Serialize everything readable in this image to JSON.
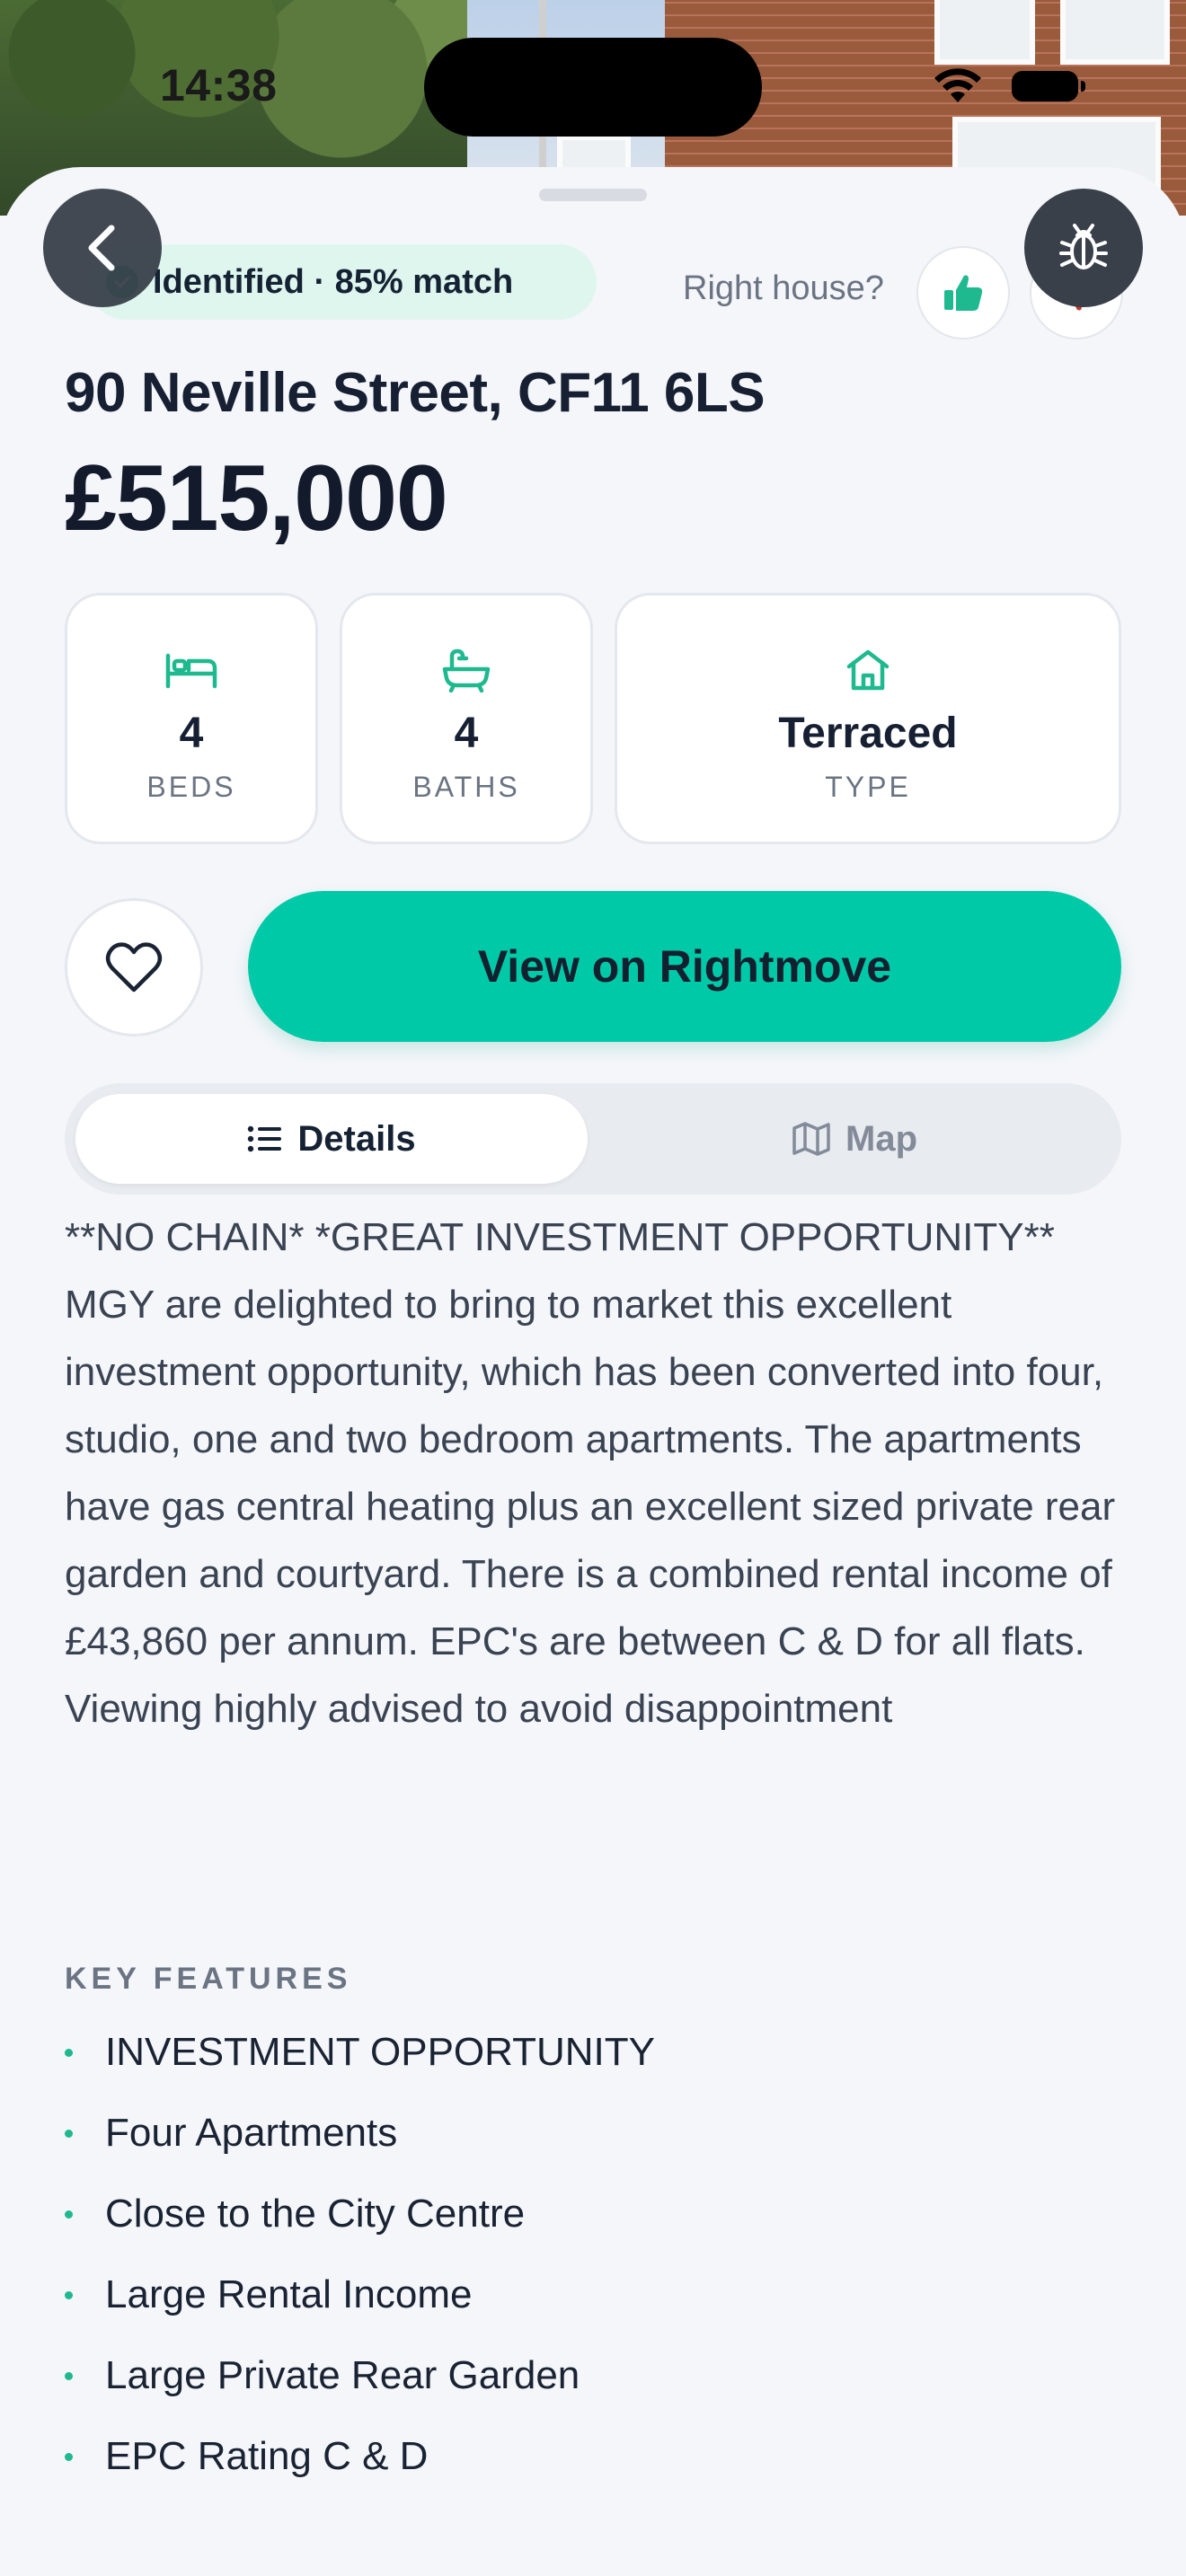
{
  "status_bar": {
    "time": "14:38"
  },
  "header": {
    "match_badge": "Identified · 85% match",
    "feedback_prompt": "Right house?"
  },
  "property": {
    "address": "90 Neville Street, CF11 6LS",
    "price": "£515,000"
  },
  "stats": [
    {
      "icon": "bed-icon",
      "value": "4",
      "label": "BEDS"
    },
    {
      "icon": "bath-icon",
      "value": "4",
      "label": "BATHS"
    },
    {
      "icon": "house-icon",
      "value": "Terraced",
      "label": "TYPE"
    }
  ],
  "actions": {
    "primary_label": "View on Rightmove"
  },
  "tabs": [
    {
      "label": "Details",
      "icon": "list-icon",
      "selected": true
    },
    {
      "label": "Map",
      "icon": "map-icon",
      "selected": false
    }
  ],
  "description": "**NO CHAIN* *GREAT INVESTMENT OPPORTUNITY** MGY are delighted to bring to market this excellent investment opportunity, which has been converted into four, studio, one and two bedroom apartments. The apartments have gas central heating plus an excellent sized private rear garden and courtyard. There is a combined rental income of £43,860 per annum. EPC's are between C & D for all flats. Viewing highly advised to avoid disappointment",
  "key_features": {
    "heading": "KEY FEATURES",
    "items": [
      "INVESTMENT OPPORTUNITY",
      "Four Apartments",
      "Close to the City Centre",
      "Large Rental Income",
      "Large Private Rear Garden",
      "EPC Rating C & D"
    ]
  },
  "colors": {
    "accent": "#00c9a7",
    "accent_dark": "#1fb98f",
    "background": "#f4f6fa",
    "text_primary": "#172033",
    "text_secondary": "#6b7483"
  }
}
